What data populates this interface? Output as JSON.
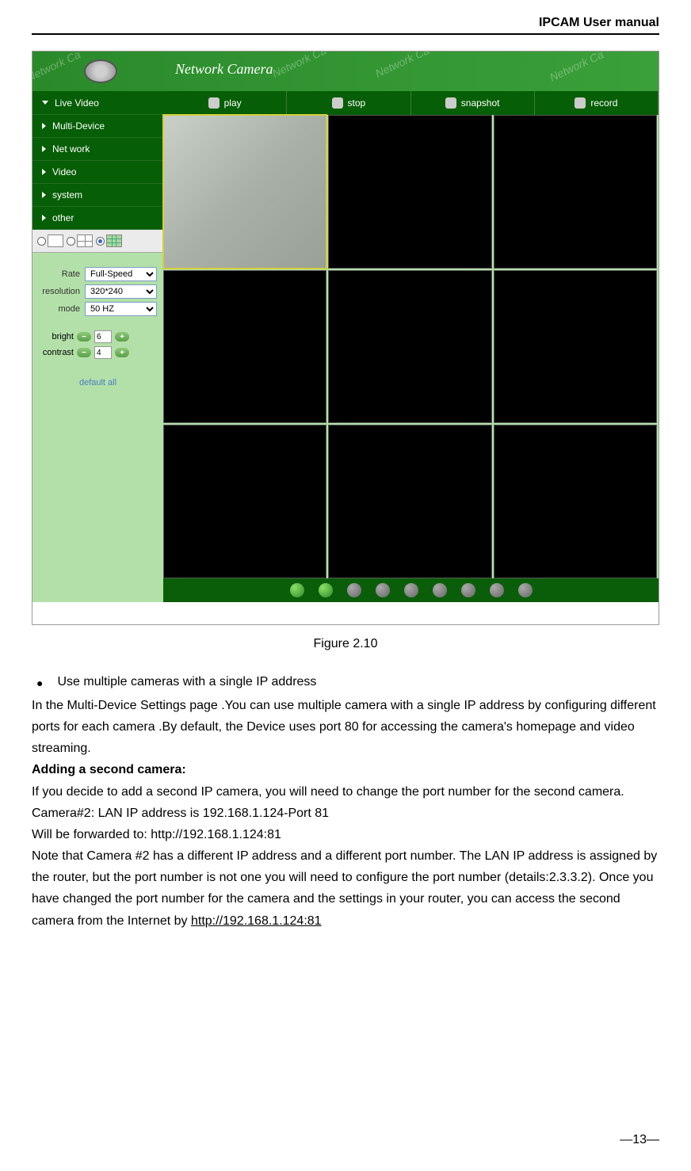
{
  "header": {
    "title": "IPCAM User manual"
  },
  "screenshot": {
    "banner_title": "Network Camera",
    "watermarks": [
      "Network Ca",
      "Network Ca",
      "Network Ca",
      "Network Ca"
    ],
    "toolbar": {
      "live_video": "Live Video",
      "play": "play",
      "stop": "stop",
      "snapshot": "snapshot",
      "record": "record"
    },
    "sidebar_nav": [
      "Multi-Device",
      "Net work",
      "Video",
      "system",
      "other"
    ],
    "settings": {
      "rate": {
        "label": "Rate",
        "value": "Full-Speed"
      },
      "resolution": {
        "label": "resolution",
        "value": "320*240"
      },
      "mode": {
        "label": "mode",
        "value": "50 HZ"
      },
      "bright": {
        "label": "bright",
        "value": "6"
      },
      "contrast": {
        "label": "contrast",
        "value": "4"
      },
      "default_link": "default all"
    }
  },
  "caption": "Figure 2.10",
  "body": {
    "bullet": "Use multiple cameras with a single IP address",
    "p1": "In the Multi-Device Settings page .You can use multiple camera with a single IP address by configuring different ports for each camera .By default, the Device uses port 80 for accessing the camera's homepage and video streaming.",
    "h_adding": "Adding a second camera:",
    "p2": "If you decide to add a second IP camera, you will need to change the port number for the second camera.",
    "p3": "Camera#2: LAN IP address is 192.168.1.124-Port 81",
    "p4": "Will be forwarded to: http://192.168.1.124:81",
    "p5a": "Note that Camera #2 has a different IP address and a different port number. The LAN IP address is assigned by the router, but the port number is not one you will need to configure the port number (details:2.3.3.2). Once you have changed the port number for the camera and the settings in your router, you can access the second camera from the Internet by ",
    "p5_link": "http://192.168.1.124:81"
  },
  "page_number": "—13—"
}
